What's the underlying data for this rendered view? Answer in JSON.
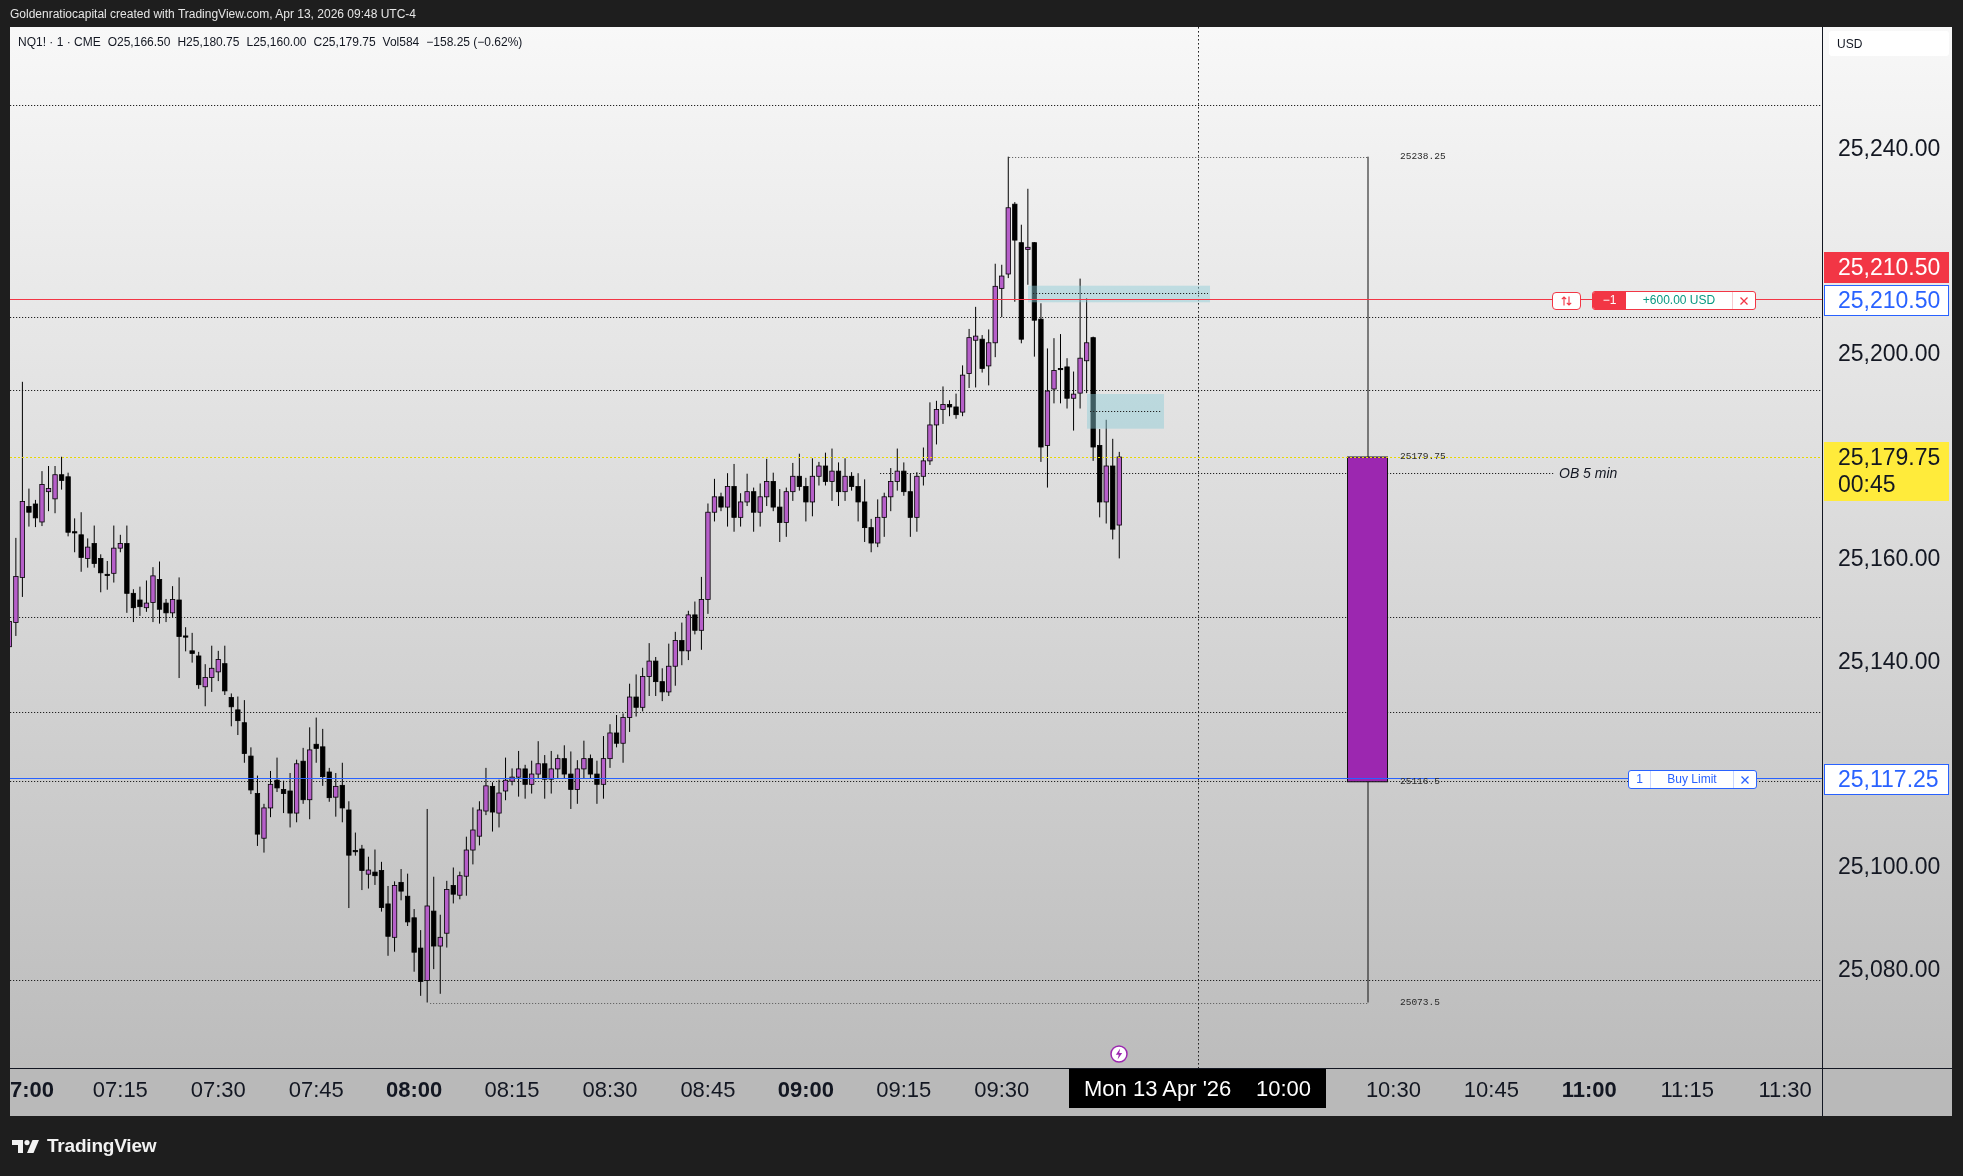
{
  "header": {
    "caption": "Goldenratiocapital created with TradingView.com, Apr 13, 2026 09:48 UTC-4"
  },
  "legend": {
    "symbol": "NQ1! · 1 · CME",
    "values": [
      "O25,166.50",
      "H25,180.75",
      "L25,160.00",
      "C25,179.75",
      "Vol584"
    ],
    "change": "−158.25 (−0.62%)"
  },
  "position": {
    "quantity": "−1",
    "pnl": "+600.00 USD"
  },
  "order": {
    "quantity": "1",
    "type": "Buy Limit"
  },
  "ob_label": "OB 5 min",
  "range_candle": {
    "price_labels": [
      "25238.25",
      "25179.75",
      "25116.5",
      "25073.5"
    ]
  },
  "price_axis": {
    "currency": "USD",
    "ticks": [
      "25,240.00",
      "25,200.00",
      "25,160.00",
      "25,140.00",
      "25,100.00",
      "25,080.00"
    ],
    "markers": [
      {
        "kind": "position",
        "text": "25,210.50"
      },
      {
        "kind": "order",
        "text": "25,210.50"
      },
      {
        "kind": "last",
        "text": "25,179.75",
        "countdown": "00:45"
      },
      {
        "kind": "order",
        "text": "25,117.25"
      }
    ]
  },
  "time_axis": {
    "left_ticks": [
      {
        "label": "7:00",
        "major": true
      },
      {
        "label": "07:15",
        "major": false
      },
      {
        "label": "07:30",
        "major": false
      },
      {
        "label": "07:45",
        "major": false
      },
      {
        "label": "08:00",
        "major": true
      },
      {
        "label": "08:15",
        "major": false
      },
      {
        "label": "08:30",
        "major": false
      },
      {
        "label": "08:45",
        "major": false
      },
      {
        "label": "09:00",
        "major": true
      },
      {
        "label": "09:15",
        "major": false
      },
      {
        "label": "09:30",
        "major": false
      }
    ],
    "crosshair": {
      "date": "Mon 13 Apr '26",
      "time": "10:00"
    },
    "right_ticks": [
      {
        "label": "10:30",
        "major": false
      },
      {
        "label": "10:45",
        "major": false
      },
      {
        "label": "11:00",
        "major": true
      },
      {
        "label": "11:15",
        "major": false
      },
      {
        "label": "11:30",
        "major": false
      }
    ]
  },
  "footer": {
    "brand": "TradingView"
  }
}
